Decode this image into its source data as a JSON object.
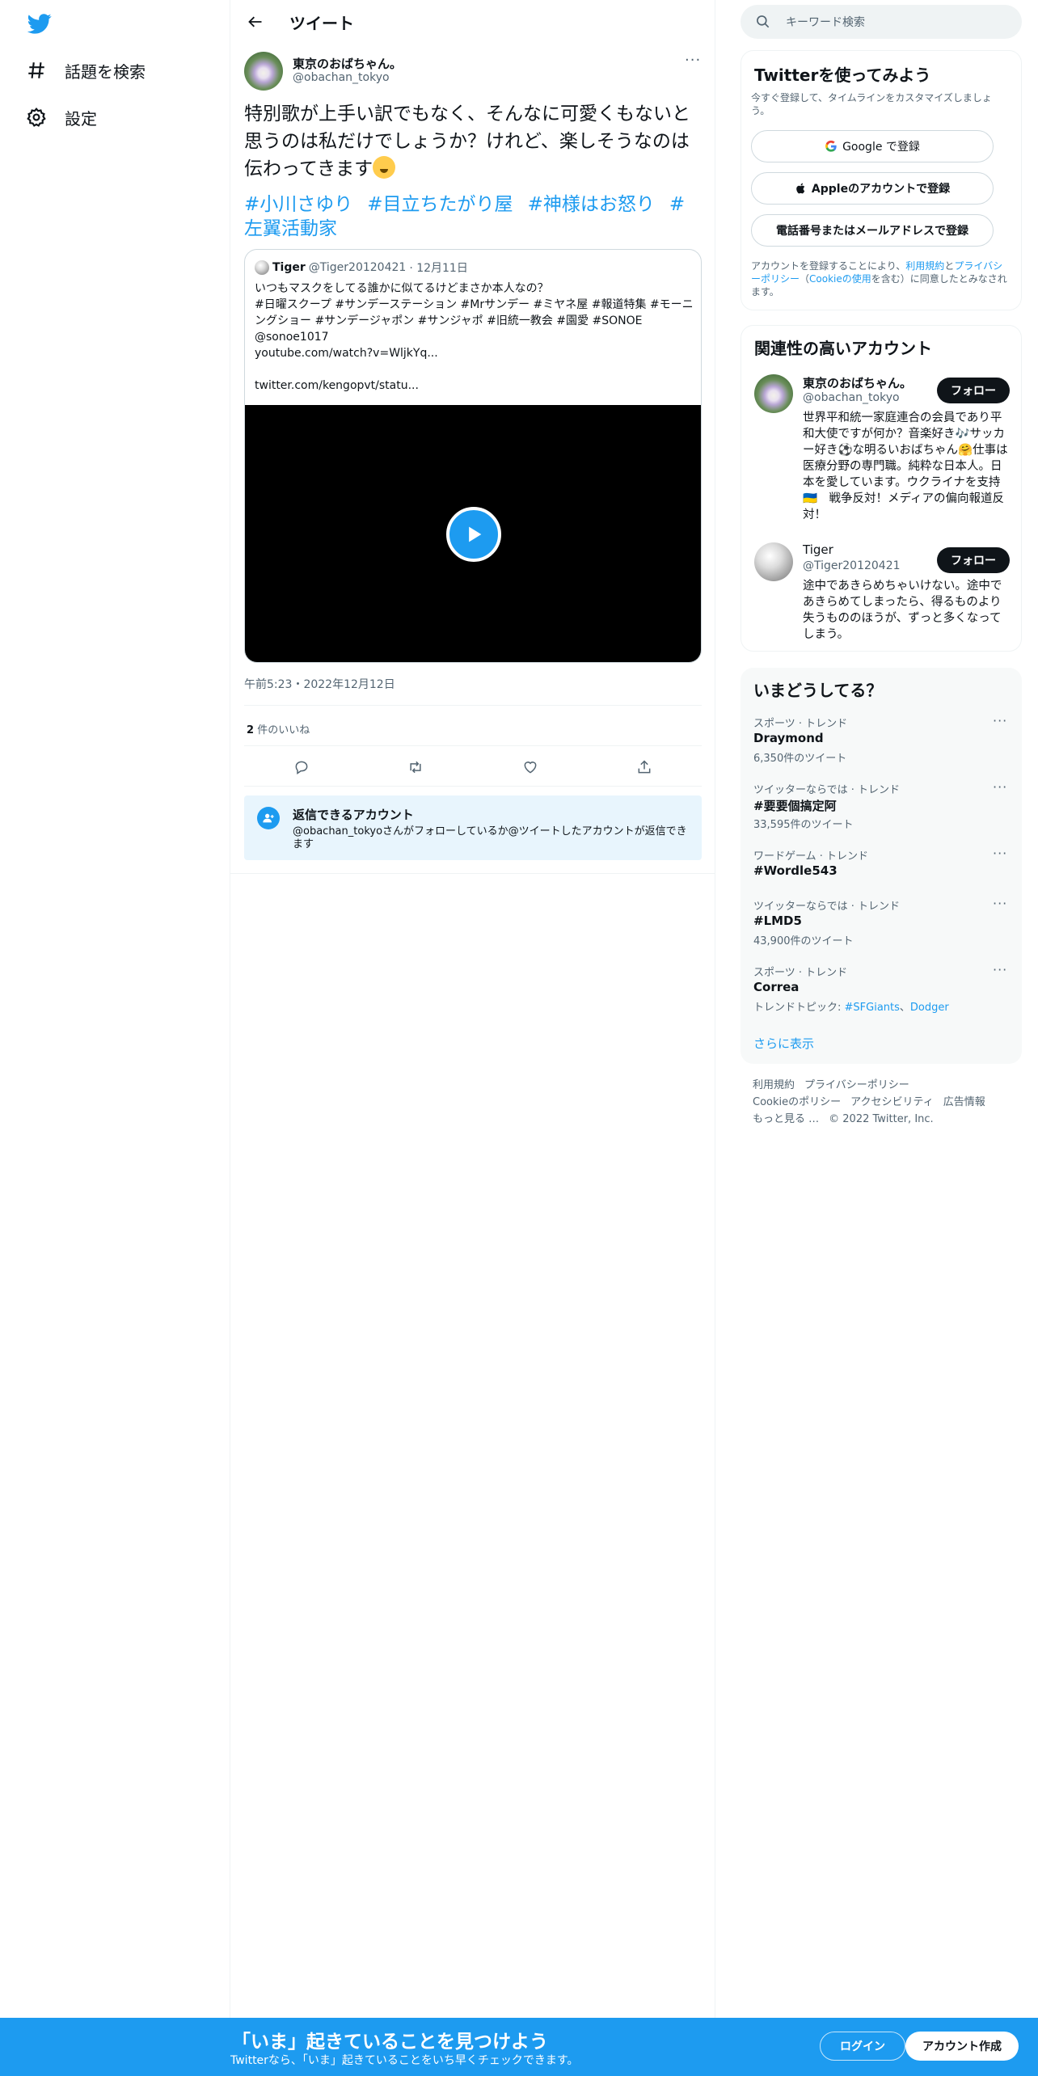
{
  "nav": {
    "items": [
      {
        "label": "話題を検索",
        "icon": "hashtag-icon"
      },
      {
        "label": "設定",
        "icon": "gear-icon"
      }
    ]
  },
  "header": {
    "title": "ツイート"
  },
  "tweet": {
    "author_name": "東京のおばちゃん。",
    "author_handle": "@obachan_tokyo",
    "text": "特別歌が上手い訳でもなく、そんなに可愛くもないと思うのは私だけでしょうか？けれど、楽しそうなのは伝わってきます",
    "hashtags": [
      "#小川さゆり",
      "#目立ちたがり屋",
      "#神様はお怒り",
      "#左翼活動家"
    ],
    "timestamp": "午前5:23・2022年12月12日",
    "likes_count": "2",
    "likes_label": "件のいいね"
  },
  "quote": {
    "name": "Tiger",
    "handle": "@Tiger20120421",
    "date": "· 12月11日",
    "lines": [
      "いつもマスクをしてる誰かに似てるけどまさか本人なの？",
      "#日曜スクープ #サンデーステーション #Mrサンデー #ミヤネ屋 #報道特集 #モーニングショー #サンデージャポン #サンジャポ #旧統一教会 #園愛 #SONOE @sonoe1017",
      "youtube.com/watch?v=WljkYq...",
      "",
      "twitter.com/kengopvt/statu..."
    ]
  },
  "reply_notice": {
    "title": "返信できるアカウント",
    "desc": "@obachan_tokyoさんがフォローしているか@ツイートしたアカウントが返信できます"
  },
  "search": {
    "placeholder": "キーワード検索"
  },
  "signup_card": {
    "title": "Twitterを使ってみよう",
    "subtitle": "今すぐ登録して、タイムラインをカスタマイズしましょう。",
    "google": "Google で登録",
    "apple": "Appleのアカウントで登録",
    "phone": "電話番号またはメールアドレスで登録",
    "terms_pre": "アカウントを登録することにより、",
    "terms_link": "利用規約",
    "terms_and": "と",
    "privacy_link": "プライバシーポリシー",
    "cookie_pre": "（",
    "cookie_link": "Cookieの使用",
    "terms_post": "を含む）に同意したとみなされます。"
  },
  "related": {
    "title": "関連性の高いアカウント",
    "accounts": [
      {
        "name": "東京のおばちゃん。",
        "handle": "@obachan_tokyo",
        "follow": "フォロー",
        "bio": "世界平和統一家庭連合の会員であり平和大使ですが何か？音楽好き🎶サッカー好き⚽な明るいおばちゃん🤗仕事は医療分野の専門職。純粋な日本人。日本を愛しています。ウクライナを支持🇺🇦　戦争反対！メディアの偏向報道反対！"
      },
      {
        "name": "Tiger",
        "handle": "@Tiger20120421",
        "follow": "フォロー",
        "bio": "途中であきらめちゃいけない。途中であきらめてしまったら、得るものより失うもののほうが、ずっと多くなってしまう。"
      }
    ]
  },
  "trends": {
    "title": "いまどうしてる？",
    "items": [
      {
        "context": "スポーツ · トレンド",
        "name": "Draymond",
        "count": "6,350件のツイート"
      },
      {
        "context": "ツイッターならでは · トレンド",
        "name": "#要要個搞定阿",
        "count": "33,595件のツイート"
      },
      {
        "context": "ワードゲーム · トレンド",
        "name": "#Wordle543",
        "count": ""
      },
      {
        "context": "ツイッターならでは · トレンド",
        "name": "#LMD5",
        "count": "43,900件のツイート"
      },
      {
        "context": "スポーツ · トレンド",
        "name": "Correa",
        "count": ""
      }
    ],
    "topic_prefix": "トレンドトピック: ",
    "topic_1": "#SFGiants",
    "topic_sep": "、",
    "topic_2": "Dodger",
    "show_more": "さらに表示"
  },
  "footer": {
    "links": [
      "利用規約",
      "プライバシーポリシー",
      "Cookieのポリシー",
      "アクセシビリティ",
      "広告情報",
      "もっと見る …"
    ],
    "copyright": "© 2022 Twitter, Inc."
  },
  "bottom_bar": {
    "title": "「いま」起きていることを見つけよう",
    "subtitle": "Twitterなら、「いま」起きていることをいち早くチェックできます。",
    "login": "ログイン",
    "signup": "アカウント作成"
  },
  "colors": {
    "accent": "#1d9bf0",
    "text": "#0f1419",
    "muted": "#536471",
    "border": "#eff3f4"
  }
}
